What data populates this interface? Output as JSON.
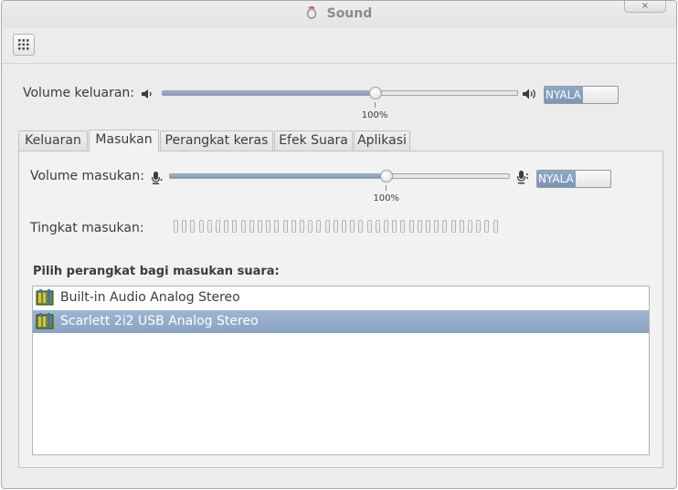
{
  "window": {
    "title": "Sound",
    "close_glyph": "×"
  },
  "toolbar": {
    "apps_icon": "grid-icon"
  },
  "output": {
    "label": "Volume keluaran:",
    "percent_label": "100%",
    "level": 0.6,
    "switch_label": "NYALA"
  },
  "tabs": [
    {
      "label": "Keluaran"
    },
    {
      "label": "Masukan",
      "active": true
    },
    {
      "label": "Perangkat keras"
    },
    {
      "label": "Efek Suara"
    },
    {
      "label": "Aplikasi"
    }
  ],
  "input": {
    "label": "Volume masukan:",
    "percent_label": "100%",
    "level": 0.64,
    "switch_label": "NYALA",
    "level_label": "Tingkat masukan:",
    "level_segments": 39,
    "devices_heading": "Pilih perangkat bagi masukan suara:",
    "devices": [
      {
        "name": "Built-in Audio Analog Stereo",
        "selected": false
      },
      {
        "name": "Scarlett 2i2 USB Analog Stereo",
        "selected": true
      }
    ]
  },
  "colors": {
    "accent": "#8aa4c3",
    "window_bg": "#ececec"
  }
}
